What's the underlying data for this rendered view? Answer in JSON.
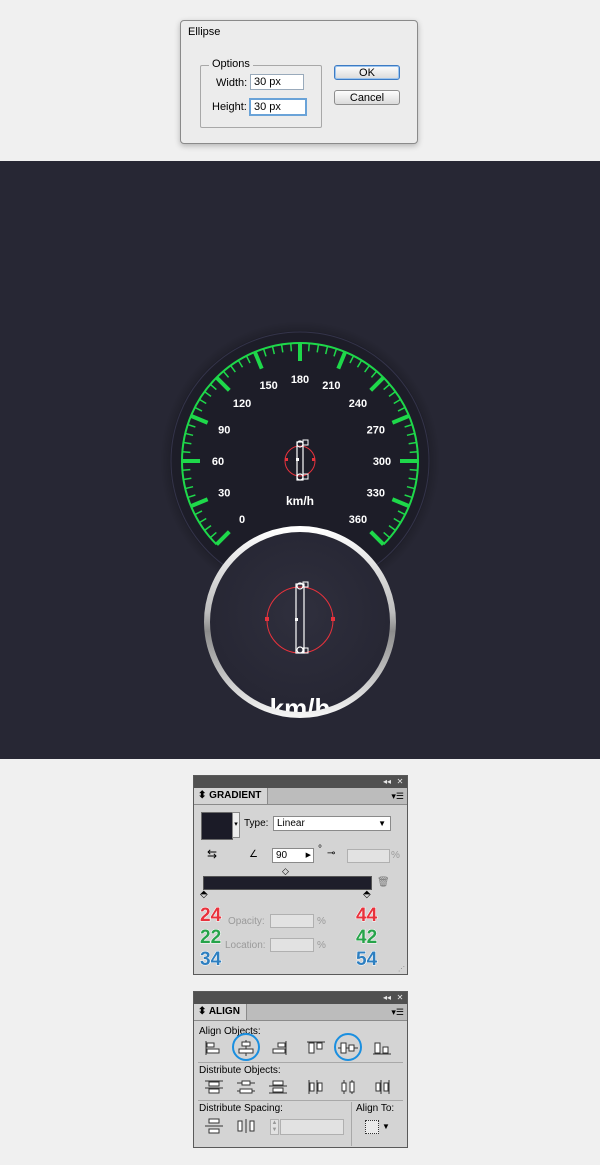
{
  "ellipse_dialog": {
    "title": "Ellipse",
    "group_label": "Options",
    "width_label": "Width:",
    "width_value": "30 px",
    "height_label": "Height:",
    "height_value": "30 px",
    "ok_label": "OK",
    "cancel_label": "Cancel"
  },
  "speedometer": {
    "tick_labels": [
      "0",
      "30",
      "60",
      "90",
      "120",
      "150",
      "180",
      "210",
      "240",
      "270",
      "300",
      "330",
      "360"
    ],
    "unit_label": "km/h",
    "zoom_unit_label": "km/h",
    "accent_color": "#1ed84a",
    "background_color": "#272734"
  },
  "gradient_panel": {
    "tab_label": "GRADIENT",
    "type_label": "Type:",
    "type_value": "Linear",
    "angle_value": "90",
    "degree_symbol": "°",
    "percent_symbol": "%",
    "opacity_label": "Opacity:",
    "location_label": "Location:",
    "left_stop": {
      "r": "24",
      "g": "22",
      "b": "34"
    },
    "right_stop": {
      "r": "44",
      "g": "42",
      "b": "54"
    }
  },
  "align_panel": {
    "tab_label": "ALIGN",
    "align_objects_label": "Align Objects:",
    "distribute_objects_label": "Distribute Objects:",
    "distribute_spacing_label": "Distribute Spacing:",
    "align_to_label": "Align To:"
  },
  "colors": {
    "red": "#e8323c",
    "green": "#27a34a",
    "blue": "#2e7fc0",
    "highlight_ring": "#1a8fe0"
  }
}
